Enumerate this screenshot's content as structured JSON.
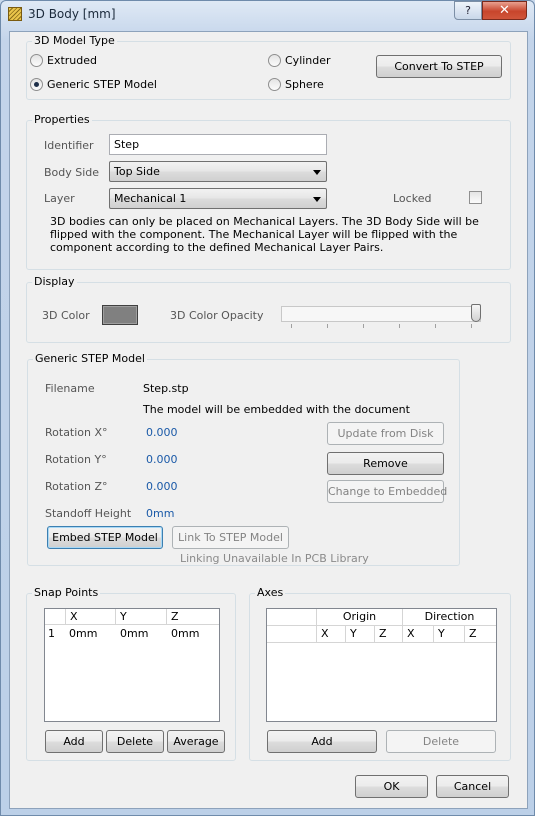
{
  "window": {
    "title": "3D Body [mm]",
    "help_label": "?",
    "close_label": "✕"
  },
  "model_type": {
    "group_label": "3D Model Type",
    "extruded_label": "Extruded",
    "generic_step_label": "Generic STEP Model",
    "cylinder_label": "Cylinder",
    "sphere_label": "Sphere",
    "selected": "Generic STEP Model",
    "convert_button": "Convert To STEP"
  },
  "properties": {
    "group_label": "Properties",
    "identifier_label": "Identifier",
    "identifier_value": "Step",
    "body_side_label": "Body Side",
    "body_side_value": "Top Side",
    "layer_label": "Layer",
    "layer_value": "Mechanical 1",
    "locked_label": "Locked",
    "locked_checked": false,
    "note_line1": "3D bodies can only be placed on Mechanical Layers. The 3D Body Side will be",
    "note_line2": "flipped with the component. The Mechanical Layer will be flipped with the",
    "note_line3": "component according to the defined Mechanical Layer Pairs."
  },
  "display": {
    "group_label": "Display",
    "color_label": "3D Color",
    "color_value": "#808080",
    "opacity_label": "3D Color Opacity",
    "opacity_level": 1.0
  },
  "step_model": {
    "group_label": "Generic STEP Model",
    "filename_label": "Filename",
    "filename_value": "Step.stp",
    "embed_note": "The model will be embedded with the document",
    "rotation_x_label": "Rotation X°",
    "rotation_x_value": "0.000",
    "rotation_y_label": "Rotation Y°",
    "rotation_y_value": "0.000",
    "rotation_z_label": "Rotation Z°",
    "rotation_z_value": "0.000",
    "standoff_label": "Standoff Height",
    "standoff_value": "0mm",
    "update_button": "Update from Disk",
    "remove_button": "Remove",
    "change_button": "Change to Embedded",
    "embed_button": "Embed STEP Model",
    "link_button": "Link To STEP Model",
    "link_note": "Linking Unavailable In PCB Library"
  },
  "snap_points": {
    "group_label": "Snap Points",
    "columns": [
      "",
      "X",
      "Y",
      "Z"
    ],
    "rows": [
      {
        "index": "1",
        "x": "0mm",
        "y": "0mm",
        "z": "0mm"
      }
    ],
    "add_button": "Add",
    "delete_button": "Delete",
    "average_button": "Average"
  },
  "axes": {
    "group_label": "Axes",
    "origin_header": "Origin",
    "direction_header": "Direction",
    "sub_columns": [
      "X",
      "Y",
      "Z",
      "X",
      "Y",
      "Z"
    ],
    "add_button": "Add",
    "delete_button": "Delete"
  },
  "footer": {
    "ok_button": "OK",
    "cancel_button": "Cancel"
  }
}
